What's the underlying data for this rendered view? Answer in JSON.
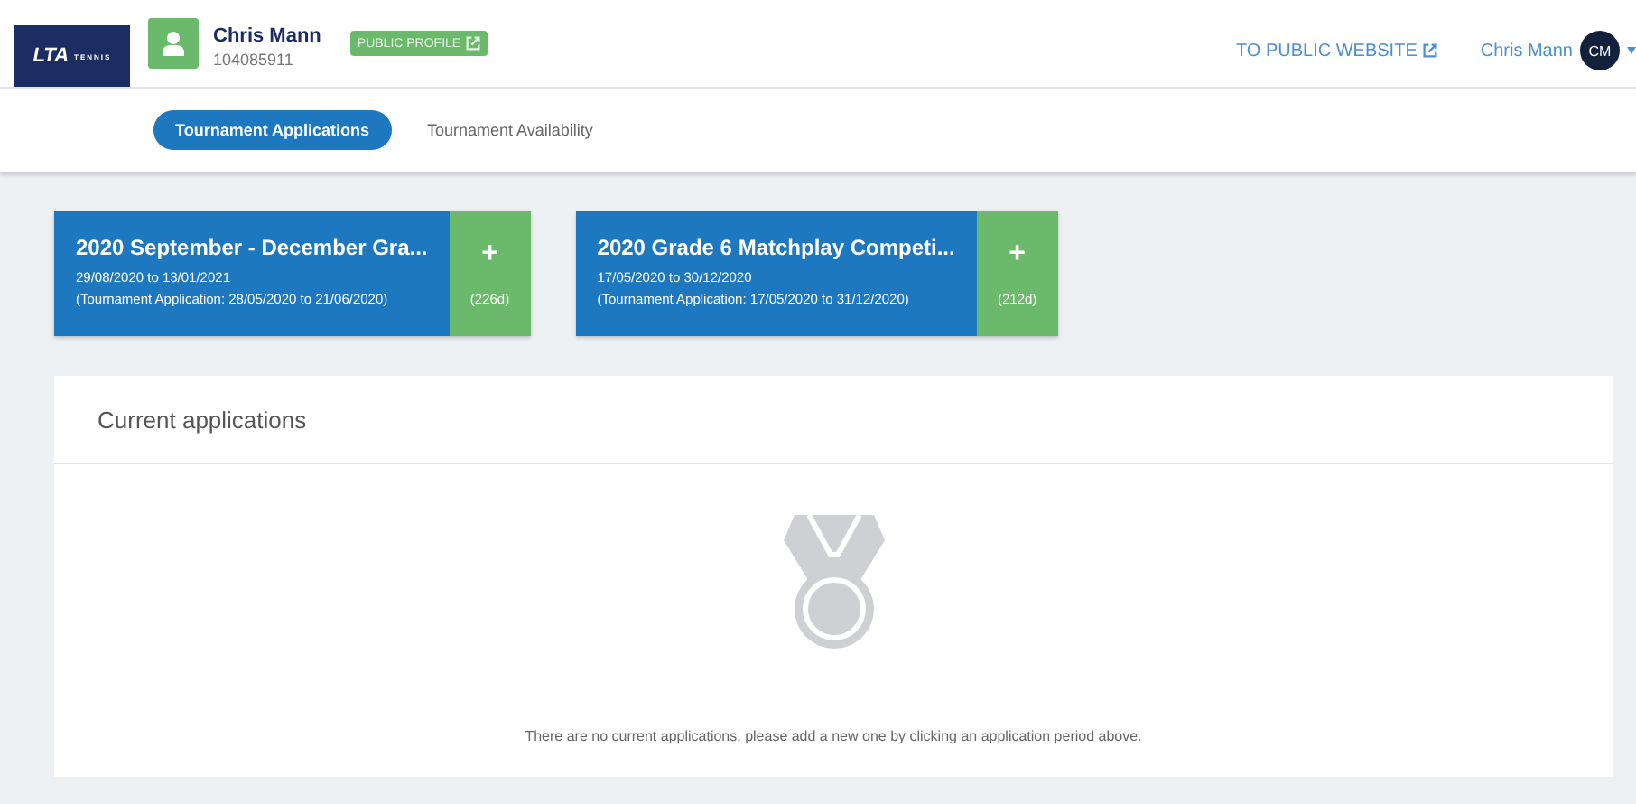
{
  "logo": {
    "text": "LTA",
    "subtext": "TENNIS"
  },
  "user": {
    "name": "Chris Mann",
    "id": "104085911",
    "profile_link": "PUBLIC PROFILE"
  },
  "top_links": {
    "website": "TO PUBLIC WEBSITE",
    "account_name": "Chris Mann",
    "initials": "CM"
  },
  "tabs": [
    {
      "label": "Tournament Applications",
      "selected": true
    },
    {
      "label": "Tournament Availability",
      "selected": false
    }
  ],
  "periods": [
    {
      "title": "2020 September - December Gra...",
      "dates": "29/08/2020 to 13/01/2021",
      "application": "(Tournament Application: 28/05/2020 to 21/06/2020)",
      "add": "+",
      "remaining": "(226d)"
    },
    {
      "title": "2020 Grade 6 Matchplay Competi...",
      "dates": "17/05/2020 to 30/12/2020",
      "application": "(Tournament Application: 17/05/2020 to 31/12/2020)",
      "add": "+",
      "remaining": "(212d)"
    }
  ],
  "current": {
    "title": "Current applications",
    "empty_message": "There are no current applications, please add a new one by clicking an application period above."
  }
}
